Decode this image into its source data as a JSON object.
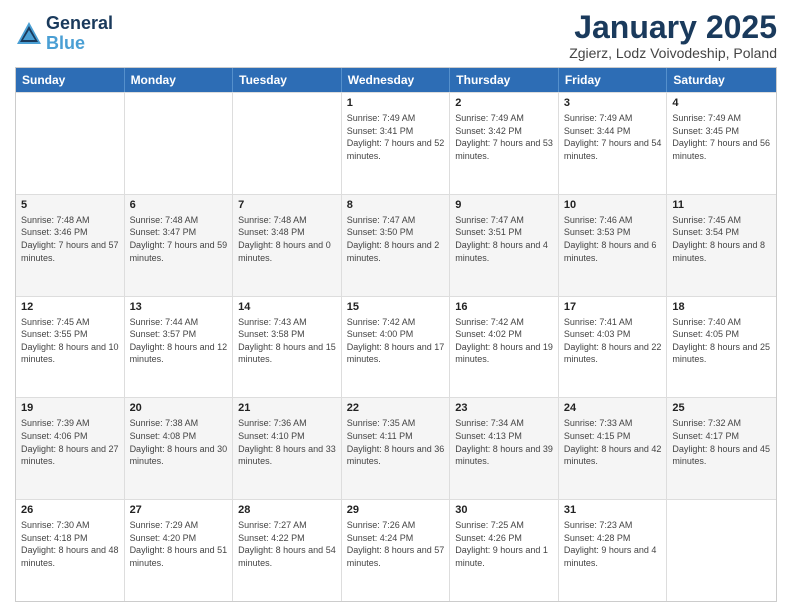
{
  "logo": {
    "line1": "General",
    "line2": "Blue"
  },
  "title": "January 2025",
  "subtitle": "Zgierz, Lodz Voivodeship, Poland",
  "header_days": [
    "Sunday",
    "Monday",
    "Tuesday",
    "Wednesday",
    "Thursday",
    "Friday",
    "Saturday"
  ],
  "rows": [
    {
      "alt": false,
      "cells": [
        {
          "day": "",
          "text": ""
        },
        {
          "day": "",
          "text": ""
        },
        {
          "day": "",
          "text": ""
        },
        {
          "day": "1",
          "text": "Sunrise: 7:49 AM\nSunset: 3:41 PM\nDaylight: 7 hours and 52 minutes."
        },
        {
          "day": "2",
          "text": "Sunrise: 7:49 AM\nSunset: 3:42 PM\nDaylight: 7 hours and 53 minutes."
        },
        {
          "day": "3",
          "text": "Sunrise: 7:49 AM\nSunset: 3:44 PM\nDaylight: 7 hours and 54 minutes."
        },
        {
          "day": "4",
          "text": "Sunrise: 7:49 AM\nSunset: 3:45 PM\nDaylight: 7 hours and 56 minutes."
        }
      ]
    },
    {
      "alt": true,
      "cells": [
        {
          "day": "5",
          "text": "Sunrise: 7:48 AM\nSunset: 3:46 PM\nDaylight: 7 hours and 57 minutes."
        },
        {
          "day": "6",
          "text": "Sunrise: 7:48 AM\nSunset: 3:47 PM\nDaylight: 7 hours and 59 minutes."
        },
        {
          "day": "7",
          "text": "Sunrise: 7:48 AM\nSunset: 3:48 PM\nDaylight: 8 hours and 0 minutes."
        },
        {
          "day": "8",
          "text": "Sunrise: 7:47 AM\nSunset: 3:50 PM\nDaylight: 8 hours and 2 minutes."
        },
        {
          "day": "9",
          "text": "Sunrise: 7:47 AM\nSunset: 3:51 PM\nDaylight: 8 hours and 4 minutes."
        },
        {
          "day": "10",
          "text": "Sunrise: 7:46 AM\nSunset: 3:53 PM\nDaylight: 8 hours and 6 minutes."
        },
        {
          "day": "11",
          "text": "Sunrise: 7:45 AM\nSunset: 3:54 PM\nDaylight: 8 hours and 8 minutes."
        }
      ]
    },
    {
      "alt": false,
      "cells": [
        {
          "day": "12",
          "text": "Sunrise: 7:45 AM\nSunset: 3:55 PM\nDaylight: 8 hours and 10 minutes."
        },
        {
          "day": "13",
          "text": "Sunrise: 7:44 AM\nSunset: 3:57 PM\nDaylight: 8 hours and 12 minutes."
        },
        {
          "day": "14",
          "text": "Sunrise: 7:43 AM\nSunset: 3:58 PM\nDaylight: 8 hours and 15 minutes."
        },
        {
          "day": "15",
          "text": "Sunrise: 7:42 AM\nSunset: 4:00 PM\nDaylight: 8 hours and 17 minutes."
        },
        {
          "day": "16",
          "text": "Sunrise: 7:42 AM\nSunset: 4:02 PM\nDaylight: 8 hours and 19 minutes."
        },
        {
          "day": "17",
          "text": "Sunrise: 7:41 AM\nSunset: 4:03 PM\nDaylight: 8 hours and 22 minutes."
        },
        {
          "day": "18",
          "text": "Sunrise: 7:40 AM\nSunset: 4:05 PM\nDaylight: 8 hours and 25 minutes."
        }
      ]
    },
    {
      "alt": true,
      "cells": [
        {
          "day": "19",
          "text": "Sunrise: 7:39 AM\nSunset: 4:06 PM\nDaylight: 8 hours and 27 minutes."
        },
        {
          "day": "20",
          "text": "Sunrise: 7:38 AM\nSunset: 4:08 PM\nDaylight: 8 hours and 30 minutes."
        },
        {
          "day": "21",
          "text": "Sunrise: 7:36 AM\nSunset: 4:10 PM\nDaylight: 8 hours and 33 minutes."
        },
        {
          "day": "22",
          "text": "Sunrise: 7:35 AM\nSunset: 4:11 PM\nDaylight: 8 hours and 36 minutes."
        },
        {
          "day": "23",
          "text": "Sunrise: 7:34 AM\nSunset: 4:13 PM\nDaylight: 8 hours and 39 minutes."
        },
        {
          "day": "24",
          "text": "Sunrise: 7:33 AM\nSunset: 4:15 PM\nDaylight: 8 hours and 42 minutes."
        },
        {
          "day": "25",
          "text": "Sunrise: 7:32 AM\nSunset: 4:17 PM\nDaylight: 8 hours and 45 minutes."
        }
      ]
    },
    {
      "alt": false,
      "cells": [
        {
          "day": "26",
          "text": "Sunrise: 7:30 AM\nSunset: 4:18 PM\nDaylight: 8 hours and 48 minutes."
        },
        {
          "day": "27",
          "text": "Sunrise: 7:29 AM\nSunset: 4:20 PM\nDaylight: 8 hours and 51 minutes."
        },
        {
          "day": "28",
          "text": "Sunrise: 7:27 AM\nSunset: 4:22 PM\nDaylight: 8 hours and 54 minutes."
        },
        {
          "day": "29",
          "text": "Sunrise: 7:26 AM\nSunset: 4:24 PM\nDaylight: 8 hours and 57 minutes."
        },
        {
          "day": "30",
          "text": "Sunrise: 7:25 AM\nSunset: 4:26 PM\nDaylight: 9 hours and 1 minute."
        },
        {
          "day": "31",
          "text": "Sunrise: 7:23 AM\nSunset: 4:28 PM\nDaylight: 9 hours and 4 minutes."
        },
        {
          "day": "",
          "text": ""
        }
      ]
    }
  ]
}
